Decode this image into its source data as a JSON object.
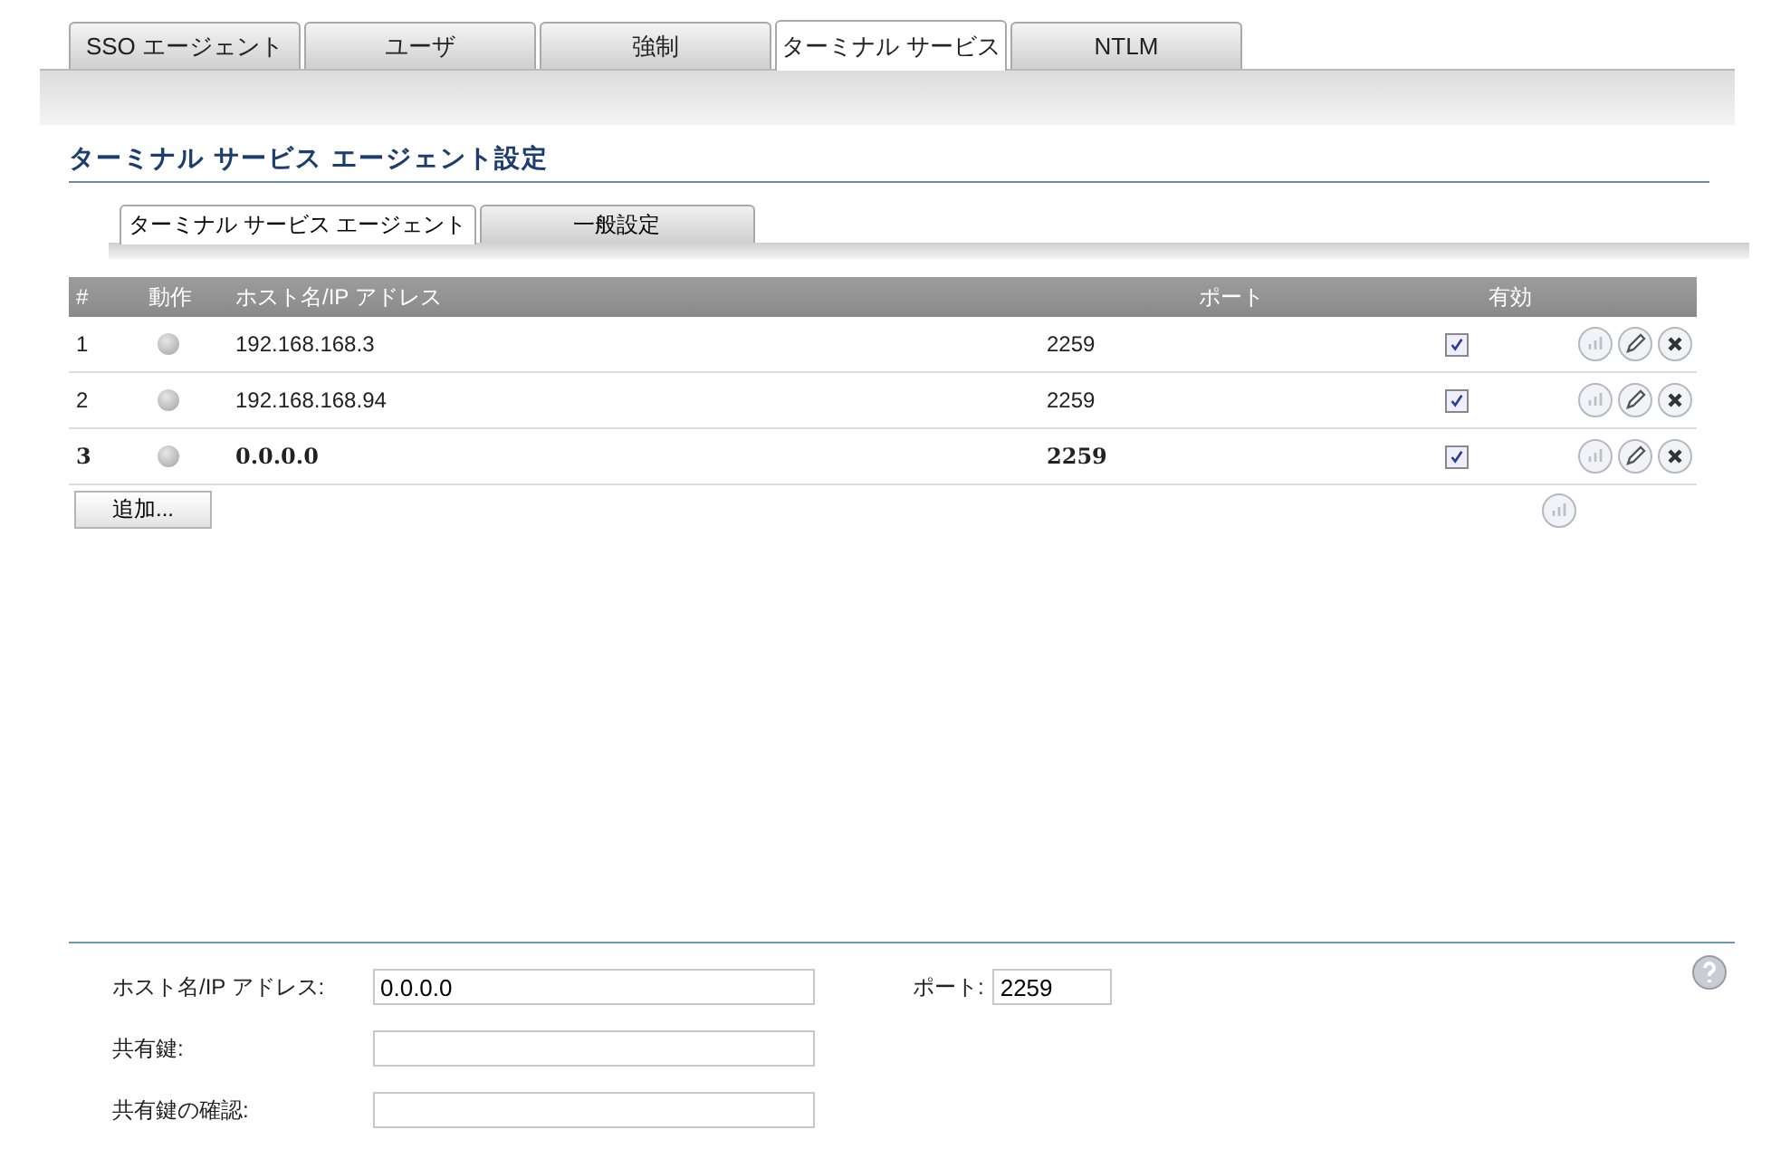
{
  "tabs": [
    {
      "label": "SSO エージェント",
      "selected": false
    },
    {
      "label": "ユーザ",
      "selected": false
    },
    {
      "label": "強制",
      "selected": false
    },
    {
      "label": "ターミナル サービス",
      "selected": true
    },
    {
      "label": "NTLM",
      "selected": false
    }
  ],
  "heading": "ターミナル サービス エージェント設定",
  "subtabs": [
    {
      "label": "ターミナル サービス エージェント",
      "selected": true
    },
    {
      "label": "一般設定",
      "selected": false
    }
  ],
  "table": {
    "columns": [
      "#",
      "動作",
      "ホスト名/IP アドレス",
      "ポート",
      "有効"
    ],
    "rows": [
      {
        "number": "1",
        "host": "192.168.168.3",
        "port": "2259",
        "enabled": true,
        "selected": false
      },
      {
        "number": "2",
        "host": "192.168.168.94",
        "port": "2259",
        "enabled": true,
        "selected": false
      },
      {
        "number": "3",
        "host": "0.0.0.0",
        "port": "2259",
        "enabled": true,
        "selected": true
      }
    ],
    "add_button": "追加..."
  },
  "form": {
    "host": {
      "label": "ホスト名/IP アドレス:",
      "value": "0.0.0.0"
    },
    "port": {
      "label": "ポート:",
      "value": "2259"
    },
    "fields": [
      {
        "label": "共有鍵:"
      },
      {
        "label": "共有鍵の確認:"
      }
    ]
  }
}
